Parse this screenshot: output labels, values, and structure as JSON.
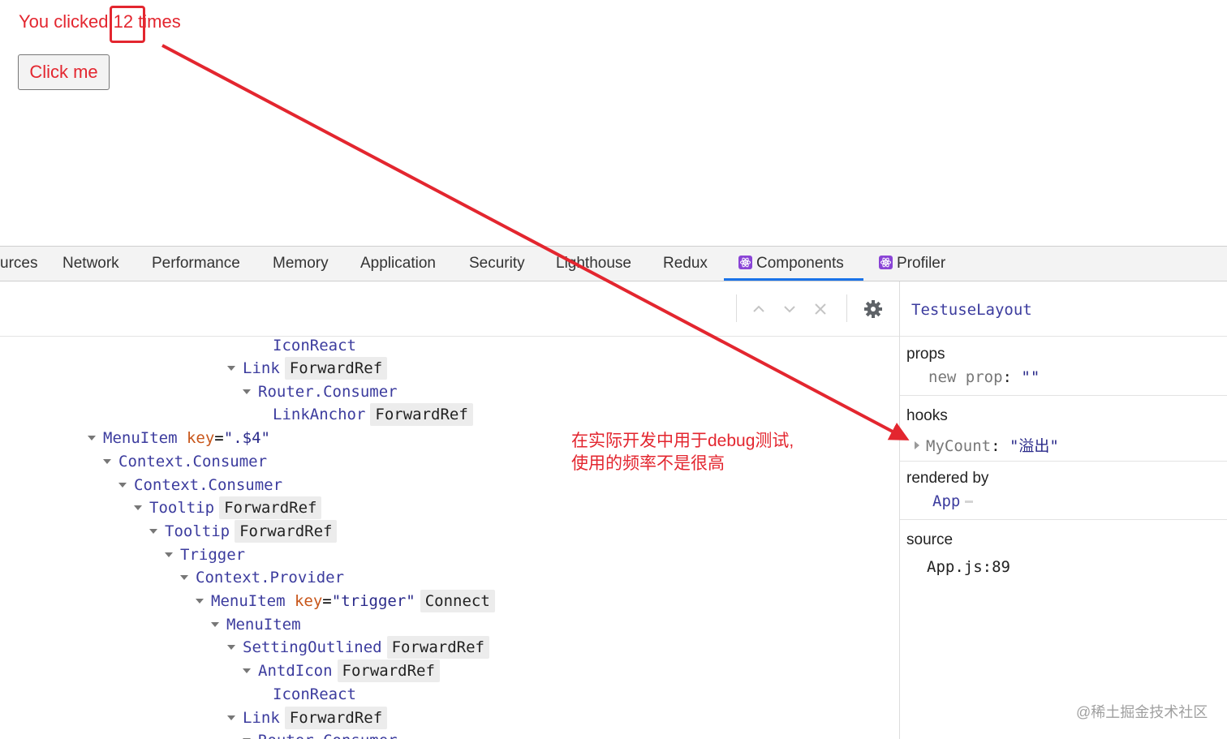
{
  "app": {
    "count_text": "You clicked 12 times",
    "button_label": "Click me"
  },
  "tabs": [
    {
      "label": "urces"
    },
    {
      "label": "Network"
    },
    {
      "label": "Performance"
    },
    {
      "label": "Memory"
    },
    {
      "label": "Application"
    },
    {
      "label": "Security"
    },
    {
      "label": "Lighthouse"
    },
    {
      "label": "Redux"
    },
    {
      "label": "Components"
    },
    {
      "label": "Profiler"
    }
  ],
  "tree": [
    {
      "name": "IconReact"
    },
    {
      "name": "Link",
      "badge": "ForwardRef"
    },
    {
      "name": "Router.Consumer"
    },
    {
      "name": "LinkAnchor",
      "badge": "ForwardRef"
    },
    {
      "name": "MenuItem",
      "key_label": "key",
      "eq": "=",
      "key_value": "\".$4\""
    },
    {
      "name": "Context.Consumer"
    },
    {
      "name": "Context.Consumer"
    },
    {
      "name": "Tooltip",
      "badge": "ForwardRef"
    },
    {
      "name": "Tooltip",
      "badge": "ForwardRef"
    },
    {
      "name": "Trigger"
    },
    {
      "name": "Context.Provider"
    },
    {
      "name": "MenuItem",
      "key_label": "key",
      "eq": "=",
      "key_value": "\"trigger\"",
      "badge": "Connect"
    },
    {
      "name": "MenuItem"
    },
    {
      "name": "SettingOutlined",
      "badge": "ForwardRef"
    },
    {
      "name": "AntdIcon",
      "badge": "ForwardRef"
    },
    {
      "name": "IconReact"
    },
    {
      "name": "Link",
      "badge": "ForwardRef"
    },
    {
      "name": "Router.Consumer"
    }
  ],
  "inspector": {
    "title": "TestuseLayout",
    "props_heading": "props",
    "prop_name": "new prop",
    "prop_colon": ":",
    "prop_value": "\"\"",
    "hooks_heading": "hooks",
    "hook_name": "MyCount",
    "hook_colon": ":",
    "hook_value": "\"溢出\"",
    "rendered_heading": "rendered by",
    "rendered_value": "App",
    "source_heading": "source",
    "source_value": "App.js:89"
  },
  "annotation": {
    "line1": "在实际开发中用于debug测试,",
    "line2": "使用的频率不是很高"
  },
  "watermark": "@稀土掘金技术社区",
  "colors": {
    "annotation_red": "#e3262f",
    "active_tab": "#1a73e8",
    "component_name": "#3c3c9e",
    "prop_key": "#c8561a"
  },
  "icons": [
    "react-icon",
    "chevron-up-icon",
    "chevron-down-icon",
    "close-icon",
    "gear-icon"
  ]
}
